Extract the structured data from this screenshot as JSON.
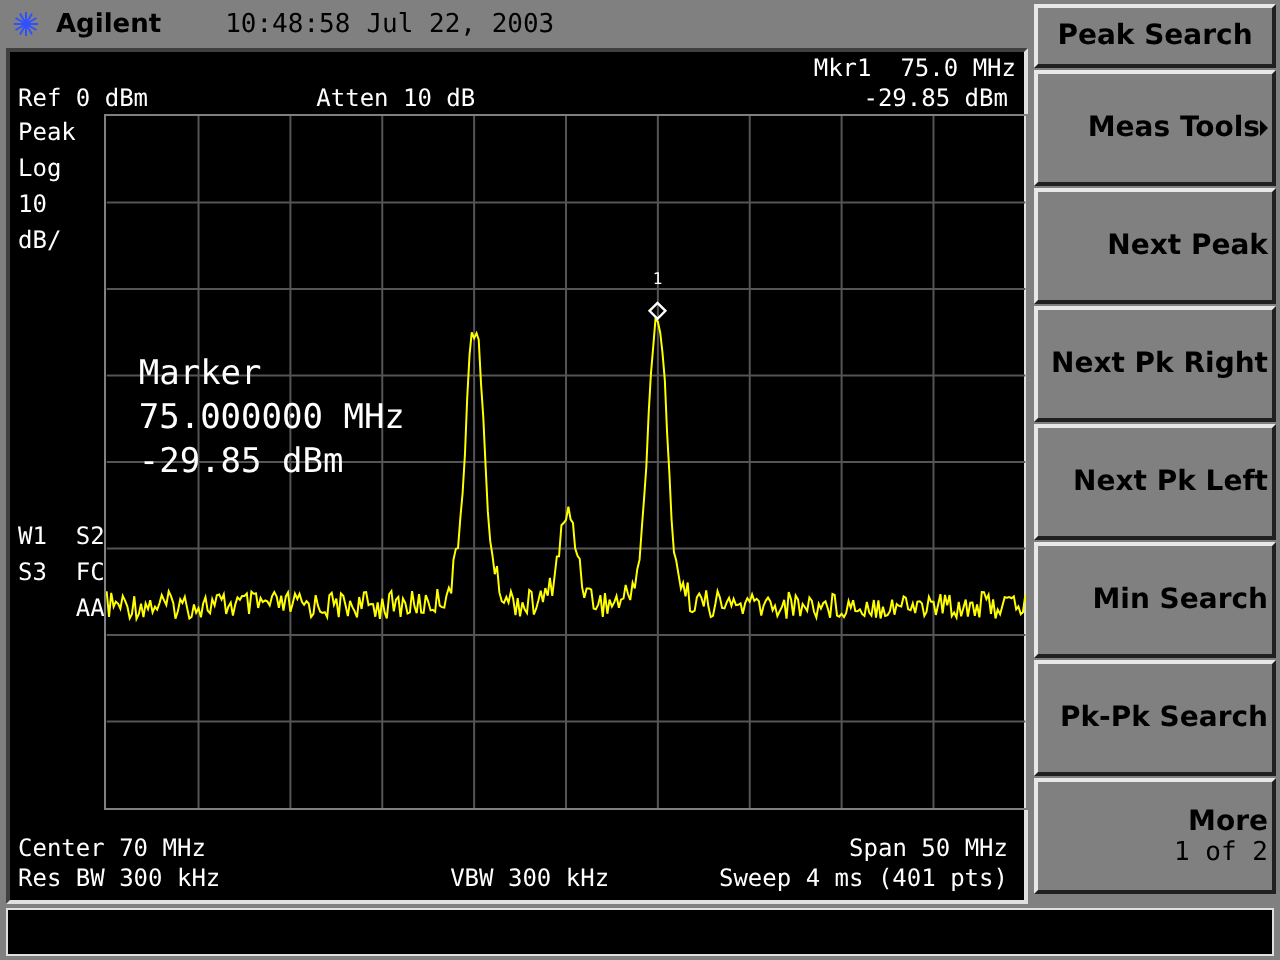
{
  "title_bar": {
    "brand": "Agilent",
    "time": "10:48:58",
    "date": "Jul 22, 2003"
  },
  "screen": {
    "marker_freq": "Mkr1  75.0 MHz",
    "ref_level": "Ref 0 dBm",
    "attenuation": "Atten 10 dB",
    "marker_amp": "-29.85 dBm",
    "left_labels": [
      "Peak",
      "Log",
      "10",
      "dB/"
    ],
    "status_labels": [
      "W1  S2",
      "S3  FC",
      "    AA"
    ],
    "marker_readout": [
      "Marker",
      "75.000000 MHz",
      "-29.85 dBm"
    ],
    "marker_number": "1",
    "center": "Center 70 MHz",
    "span": "Span 50 MHz",
    "res_bw": "Res BW 300 kHz",
    "vbw": "VBW 300 kHz",
    "sweep": "Sweep 4 ms (401 pts)"
  },
  "menu": {
    "title": "Peak Search",
    "keys": [
      {
        "label": "Meas Tools",
        "submenu": true
      },
      {
        "label": "Next Peak",
        "submenu": false
      },
      {
        "label": "Next Pk Right",
        "submenu": false
      },
      {
        "label": "Next Pk Left",
        "submenu": false
      },
      {
        "label": "Min Search",
        "submenu": false
      },
      {
        "label": "Pk-Pk Search",
        "submenu": false
      },
      {
        "label": "More",
        "sub": "1 of 2",
        "submenu": false
      }
    ]
  }
}
